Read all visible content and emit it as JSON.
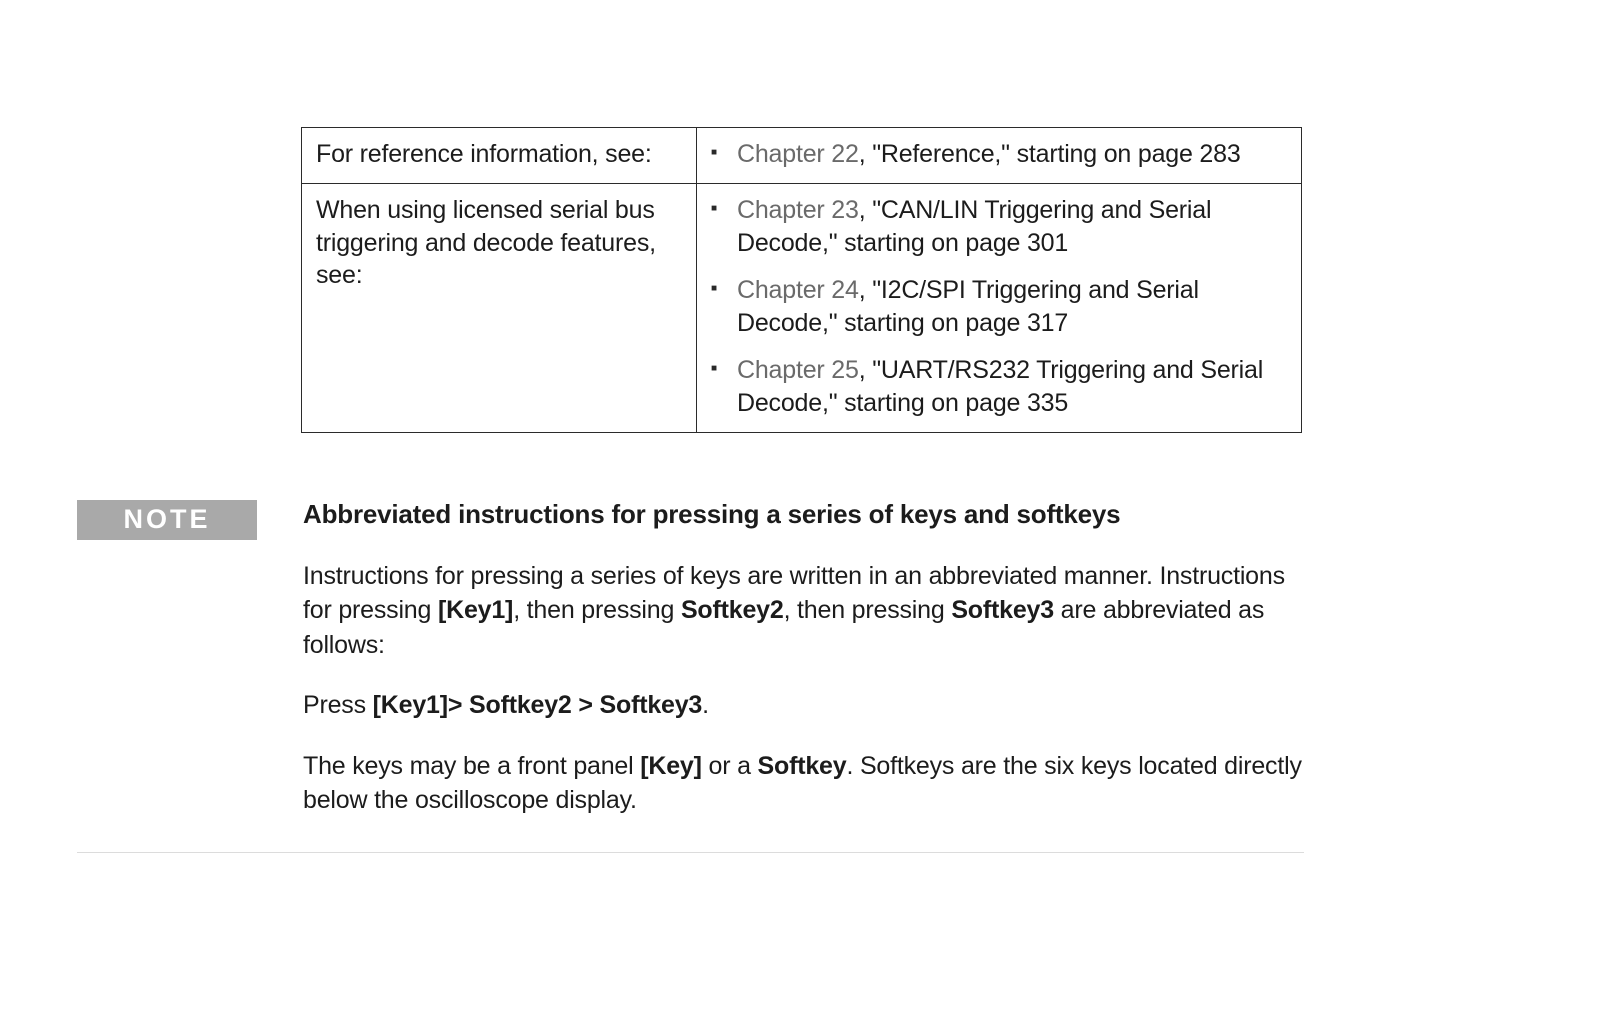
{
  "table": {
    "rows": [
      {
        "label": "For reference information, see:",
        "items": [
          {
            "chapter_prefix": "Chapter 22",
            "suffix": ", \"Reference,\" starting on page 283"
          }
        ]
      },
      {
        "label": "When using licensed serial bus triggering and decode features, see:",
        "items": [
          {
            "chapter_prefix": "Chapter 23",
            "suffix": ", \"CAN/LIN Triggering and Serial Decode,\" starting on page 301"
          },
          {
            "chapter_prefix": "Chapter 24",
            "suffix": ", \"I2C/SPI Triggering and Serial Decode,\" starting on page 317"
          },
          {
            "chapter_prefix": "Chapter 25",
            "suffix": ", \"UART/RS232 Triggering and Serial Decode,\" starting on page 335"
          }
        ]
      }
    ]
  },
  "note": {
    "badge": "NOTE",
    "header": "Abbreviated instructions for pressing a series of keys and softkeys",
    "para1": {
      "t1": "Instructions for pressing a series of keys are written in an abbreviated manner. Instructions for pressing ",
      "key1": "[Key1]",
      "t2": ", then pressing ",
      "sk2": "Softkey2",
      "t3": ", then pressing ",
      "sk3": "Softkey3",
      "t4": " are abbreviated as follows:"
    },
    "para2": {
      "t1": "Press ",
      "seq": "[Key1]> Softkey2 > Softkey3",
      "t2": "."
    },
    "para3": {
      "t1": "The keys may be a front panel ",
      "key": "[Key]",
      "t2": " or a ",
      "sk": "Softkey",
      "t3": ". Softkeys are the six keys located directly below the oscilloscope display."
    }
  }
}
